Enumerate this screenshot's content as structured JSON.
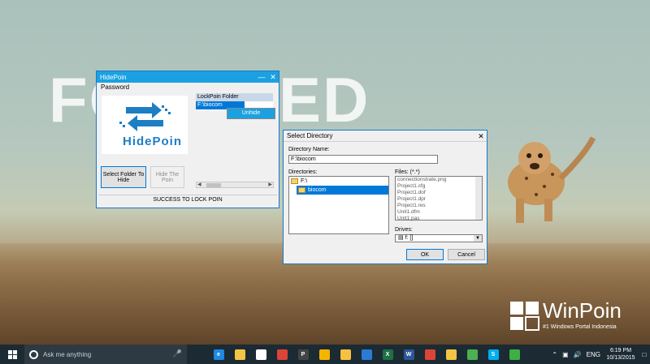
{
  "wallpaper": {
    "headline": "FOCUSED",
    "brand_name": "WinPoin",
    "brand_tagline": "#1 Windows Portal Indonesia"
  },
  "hidepoin": {
    "title": "HidePoin",
    "password_label": "Password",
    "logo_text": "HidePoin",
    "list_header": "LockPoin Folder",
    "list_items": [
      "F:\\biocom"
    ],
    "context_menu_item": "Unhide",
    "select_button": "Select Folder To Hide",
    "hide_button": "Hide The Poin",
    "status": "SUCCESS TO LOCK POIN"
  },
  "select_directory": {
    "title": "Select Directory",
    "dir_name_label": "Directory Name:",
    "dir_name_value": "F:\\biocom",
    "directories_label": "Directories:",
    "directories": [
      {
        "name": "F:\\",
        "selected": false
      },
      {
        "name": "biocom",
        "selected": true
      }
    ],
    "files_label": "Files: (*.*)",
    "files": [
      "connectionstrate.png",
      "Project1.cfg",
      "Project1.dof",
      "Project1.dpr",
      "Project1.res",
      "Unit1.dfm",
      "Unit1.pas"
    ],
    "drives_label": "Drives:",
    "drive_value": "f: []",
    "ok_button": "OK",
    "cancel_button": "Cancel"
  },
  "taskbar": {
    "search_placeholder": "Ask me anything",
    "apps": [
      {
        "name": "task-view-icon",
        "label": "",
        "color": "#1c2a33"
      },
      {
        "name": "edge-icon",
        "label": "e",
        "color": "#1e88e5"
      },
      {
        "name": "file-explorer-icon",
        "label": "",
        "color": "#f4c542"
      },
      {
        "name": "store-icon",
        "label": "",
        "color": "#ffffff"
      },
      {
        "name": "chrome-icon",
        "label": "",
        "color": "#db4437"
      },
      {
        "name": "app-p-icon",
        "label": "P",
        "color": "#444444"
      },
      {
        "name": "lock-app-icon",
        "label": "",
        "color": "#f4b400"
      },
      {
        "name": "emoji-app-icon",
        "label": "",
        "color": "#f6c23e"
      },
      {
        "name": "network-app-icon",
        "label": "",
        "color": "#2b7bd6"
      },
      {
        "name": "excel-icon",
        "label": "X",
        "color": "#1d7044"
      },
      {
        "name": "word-icon",
        "label": "W",
        "color": "#2b579a"
      },
      {
        "name": "chrome2-icon",
        "label": "",
        "color": "#db4437"
      },
      {
        "name": "warning-app-icon",
        "label": "",
        "color": "#f4c542"
      },
      {
        "name": "app-green-icon",
        "label": "",
        "color": "#4caf50"
      },
      {
        "name": "skype-icon",
        "label": "S",
        "color": "#00aff0"
      },
      {
        "name": "torrent-icon",
        "label": "",
        "color": "#3cb043"
      }
    ],
    "language": "ENG",
    "time": "6:19 PM",
    "date": "10/13/2015"
  }
}
